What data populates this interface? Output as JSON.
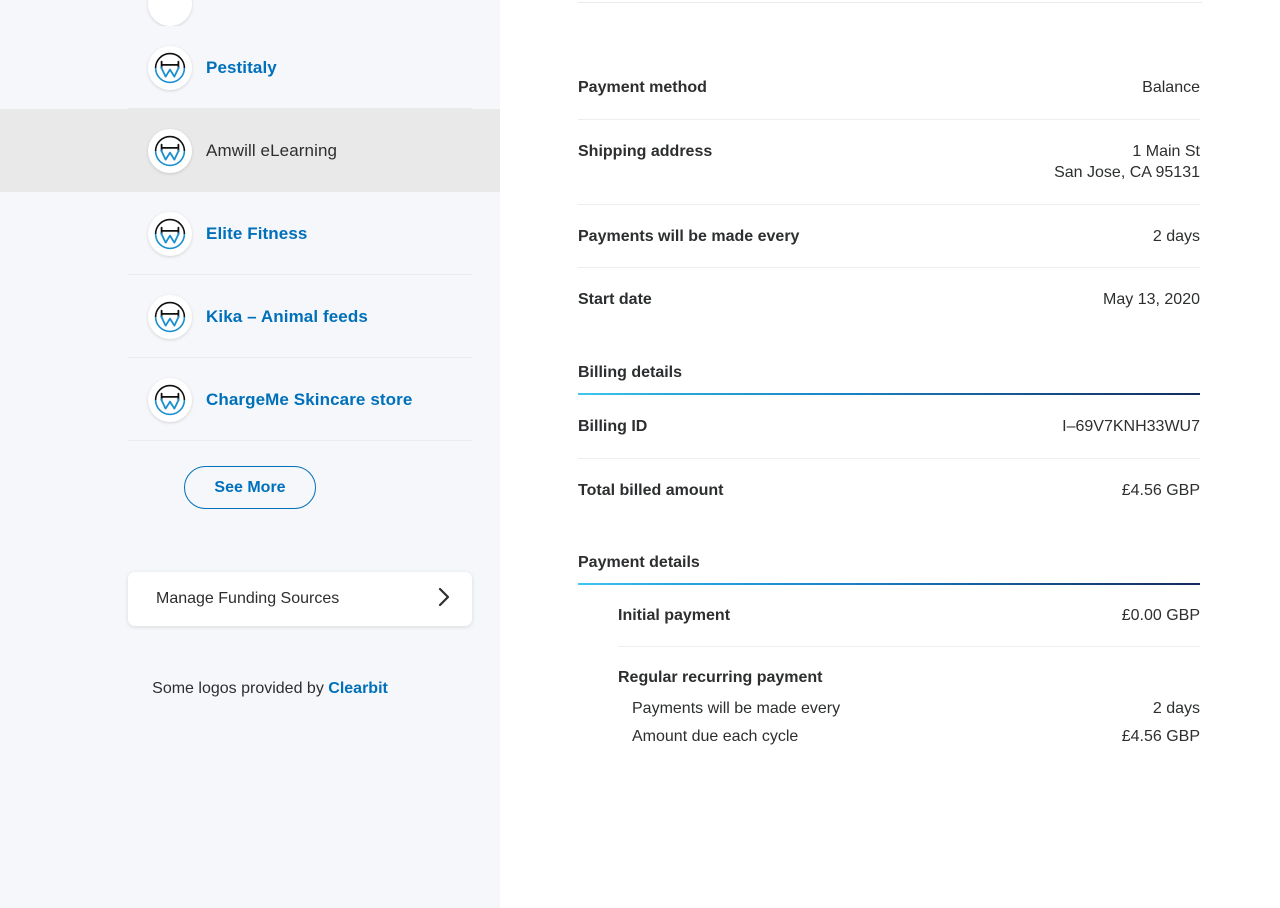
{
  "sidebar": {
    "merchants": [
      {
        "name": "Pestitaly",
        "selected": false,
        "logo_icon": "merchant-monogram-icon"
      },
      {
        "name": "Amwill eLearning",
        "selected": true,
        "logo_icon": "merchant-monogram-icon"
      },
      {
        "name": "Elite Fitness",
        "selected": false,
        "logo_icon": "merchant-monogram-icon"
      },
      {
        "name": "Kika – Animal feeds",
        "selected": false,
        "logo_icon": "merchant-monogram-icon"
      },
      {
        "name": "ChargeMe Skincare store",
        "selected": false,
        "logo_icon": "merchant-monogram-icon"
      }
    ],
    "see_more_label": "See More",
    "funding_sources_label": "Manage Funding Sources",
    "funding_sources_icon": "chevron-right-icon",
    "logos_note_prefix": "Some logos provided by ",
    "logos_note_brand": "Clearbit",
    "colors": {
      "link_blue": "#0070ba",
      "panel_bg": "#f5f7fa",
      "selected_bg": "#e9e9e9"
    }
  },
  "detail": {
    "summary_rows": [
      {
        "label": "Payment method",
        "value": "Balance"
      },
      {
        "label": "Shipping address",
        "value": "1 Main St\nSan Jose, CA 95131"
      },
      {
        "label": "Payments will be made every",
        "value": "2 days"
      },
      {
        "label": "Start date",
        "value": "May 13, 2020"
      }
    ],
    "billing": {
      "title": "Billing details",
      "rows": [
        {
          "label": "Billing ID",
          "value": "I–69V7KNH33WU7"
        },
        {
          "label": "Total billed amount",
          "value": "£4.56 GBP"
        }
      ]
    },
    "payment": {
      "title": "Payment details",
      "initial": {
        "label": "Initial payment",
        "value": "£0.00 GBP"
      },
      "recurring": {
        "title": "Regular recurring payment",
        "lines": [
          {
            "label": "Payments will be made every",
            "value": "2 days"
          },
          {
            "label": "Amount due each cycle",
            "value": "£4.56 GBP"
          }
        ]
      }
    },
    "colors": {
      "rule_gradient_start": "#3ec7f0",
      "rule_gradient_end": "#132b5c",
      "text": "#2c2e2f"
    }
  }
}
